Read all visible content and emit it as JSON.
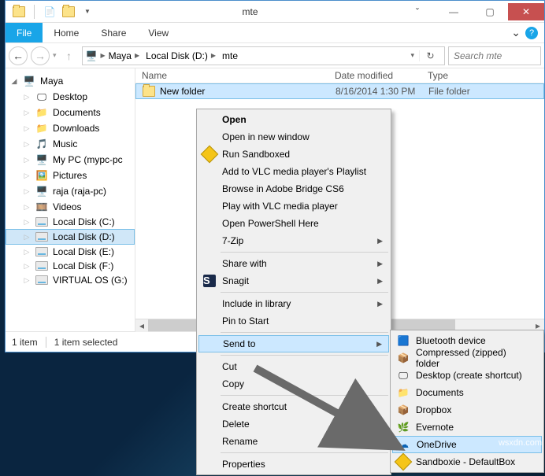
{
  "titlebar": {
    "title": "mte"
  },
  "menubar": {
    "file": "File",
    "tabs": [
      "Home",
      "Share",
      "View"
    ]
  },
  "breadcrumb": {
    "parts": [
      "Maya",
      "Local Disk (D:)",
      "mte"
    ]
  },
  "search": {
    "placeholder": "Search mte"
  },
  "tree": {
    "root": "Maya",
    "items": [
      {
        "label": "Desktop",
        "ico": "desktop"
      },
      {
        "label": "Documents",
        "ico": "folder"
      },
      {
        "label": "Downloads",
        "ico": "folder"
      },
      {
        "label": "Music",
        "ico": "music"
      },
      {
        "label": "My PC (mypc-pc",
        "ico": "pc"
      },
      {
        "label": "Pictures",
        "ico": "pictures"
      },
      {
        "label": "raja (raja-pc)",
        "ico": "pc"
      },
      {
        "label": "Videos",
        "ico": "video"
      },
      {
        "label": "Local Disk (C:)",
        "ico": "drive"
      },
      {
        "label": "Local Disk (D:)",
        "ico": "drive",
        "sel": true
      },
      {
        "label": "Local Disk (E:)",
        "ico": "drive"
      },
      {
        "label": "Local Disk (F:)",
        "ico": "drive"
      },
      {
        "label": "VIRTUAL OS (G:)",
        "ico": "drive"
      }
    ]
  },
  "columns": {
    "name": "Name",
    "date": "Date modified",
    "type": "Type"
  },
  "rows": [
    {
      "name": "New folder",
      "date": "8/16/2014 1:30 PM",
      "type": "File folder"
    }
  ],
  "status": {
    "count": "1 item",
    "selected": "1 item selected"
  },
  "ctx": {
    "items": [
      {
        "label": "Open",
        "bold": true
      },
      {
        "label": "Open in new window"
      },
      {
        "label": "Run Sandboxed",
        "ico": "sandbox"
      },
      {
        "label": "Add to VLC media player's Playlist"
      },
      {
        "label": "Browse in Adobe Bridge CS6"
      },
      {
        "label": "Play with VLC media player"
      },
      {
        "label": "Open PowerShell Here"
      },
      {
        "label": "7-Zip",
        "sub": true
      },
      {
        "sep": true
      },
      {
        "label": "Share with",
        "sub": true
      },
      {
        "label": "Snagit",
        "ico": "snagit",
        "sub": true
      },
      {
        "sep": true
      },
      {
        "label": "Include in library",
        "sub": true
      },
      {
        "label": "Pin to Start"
      },
      {
        "sep": true
      },
      {
        "label": "Send to",
        "sub": true,
        "hl": true
      },
      {
        "sep": true
      },
      {
        "label": "Cut"
      },
      {
        "label": "Copy"
      },
      {
        "sep": true
      },
      {
        "label": "Create shortcut"
      },
      {
        "label": "Delete"
      },
      {
        "label": "Rename"
      },
      {
        "sep": true
      },
      {
        "label": "Properties"
      }
    ]
  },
  "sendto": {
    "items": [
      {
        "label": "Bluetooth device",
        "ico": "bluetooth"
      },
      {
        "label": "Compressed (zipped) folder",
        "ico": "zip"
      },
      {
        "label": "Desktop (create shortcut)",
        "ico": "desktop"
      },
      {
        "label": "Documents",
        "ico": "folder"
      },
      {
        "label": "Dropbox",
        "ico": "dropbox"
      },
      {
        "label": "Evernote",
        "ico": "evernote"
      },
      {
        "label": "OneDrive",
        "ico": "onedrive",
        "hl": true
      },
      {
        "label": "Sandboxie - DefaultBox",
        "ico": "sandbox"
      }
    ]
  },
  "watermark": "wsxdn.com"
}
